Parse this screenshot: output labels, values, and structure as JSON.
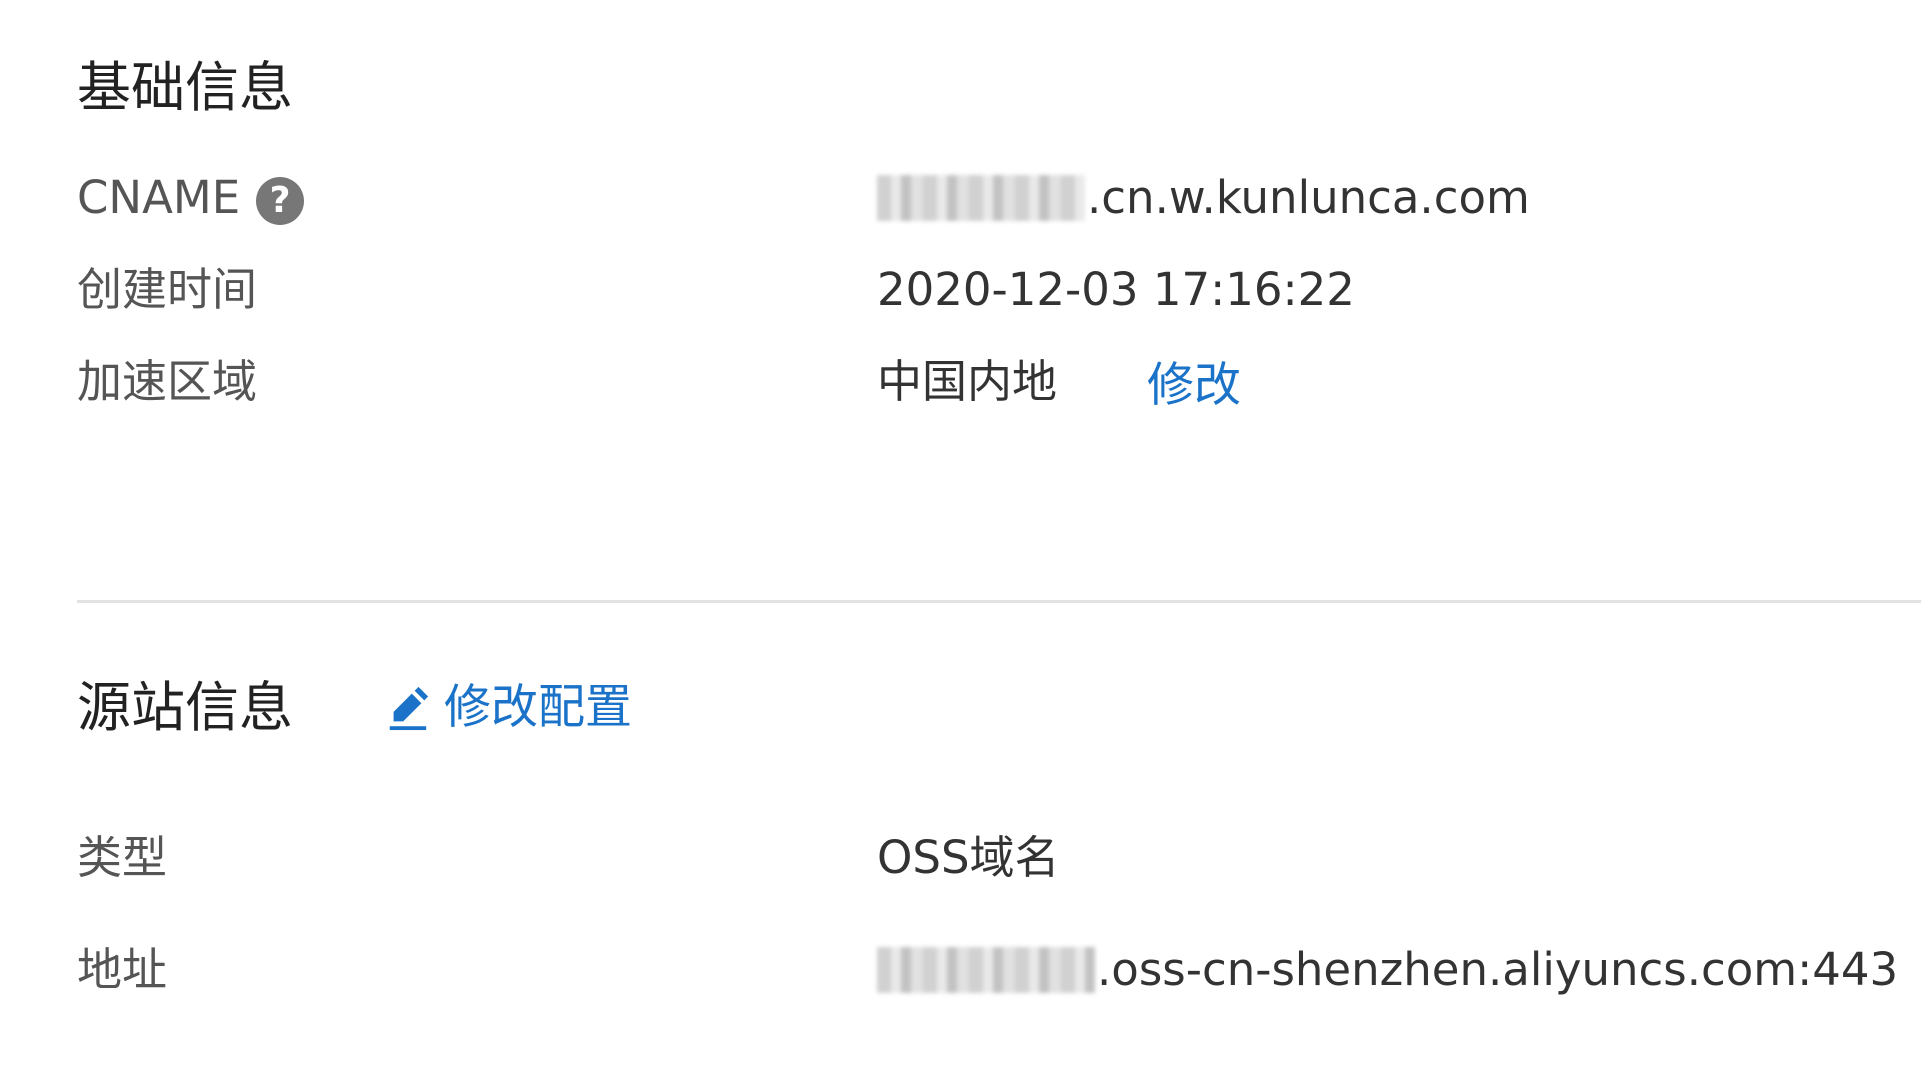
{
  "basic_info": {
    "title": "基础信息",
    "rows": [
      {
        "label": "CNAME",
        "value": ".cn.w.kunlunca.com"
      },
      {
        "label": "创建时间",
        "value": "2020-12-03 17:16:22"
      },
      {
        "label": "加速区域",
        "value": "中国内地",
        "action": "修改"
      }
    ],
    "help_icon": "question-circle-icon"
  },
  "origin_info": {
    "title": "源站信息",
    "edit_label": "修改配置",
    "edit_icon": "pencil-icon",
    "rows": [
      {
        "label": "类型",
        "value": "OSS域名"
      },
      {
        "label": "地址",
        "value": ".oss-cn-shenzhen.aliyuncs.com:443"
      }
    ]
  },
  "colors": {
    "link": "#1a73c8",
    "label": "#555555",
    "value": "#333333",
    "divider": "#e3e3e3"
  }
}
